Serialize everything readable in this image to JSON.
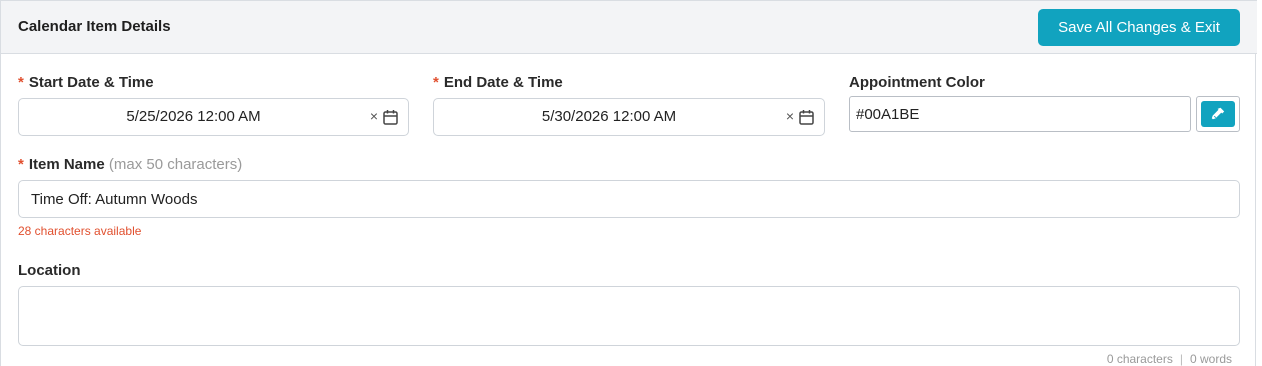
{
  "header": {
    "title": "Calendar Item Details",
    "save_label": "Save All Changes & Exit"
  },
  "colors": {
    "accent": "#11A3BF",
    "required": "#E1502F",
    "header_bg": "#F3F4F6"
  },
  "start": {
    "required_mark": "*",
    "label": "Start Date & Time",
    "value": "5/25/2026 12:00 AM",
    "clear": "×"
  },
  "end": {
    "required_mark": "*",
    "label": "End Date & Time",
    "value": "5/30/2026 12:00 AM",
    "clear": "×"
  },
  "appointment_color": {
    "label": "Appointment Color",
    "value": "#00A1BE",
    "picker_icon": "eyedropper-icon"
  },
  "item_name": {
    "required_mark": "*",
    "label": "Item Name",
    "hint": "(max 50 characters)",
    "value": "Time Off: Autumn Woods",
    "available": "28 characters available"
  },
  "location": {
    "label": "Location",
    "value": "",
    "char_count": "0 characters",
    "separator": "|",
    "word_count": "0 words"
  }
}
